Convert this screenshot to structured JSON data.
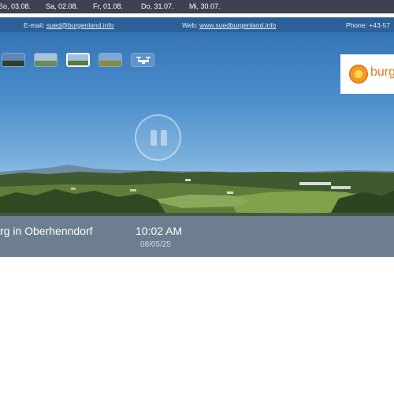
{
  "date_bar": {
    "dates": [
      "So, 03.08.",
      "Sa, 02.08.",
      "Fr, 01.08.",
      "Do, 31.07.",
      "Mi, 30.07."
    ]
  },
  "contact": {
    "email_label": "E-mail:",
    "email": "sued@burgenland.info",
    "web_label": "Web:",
    "web": "www.suedburgenland.info",
    "phone": "Phone: +43-57"
  },
  "thumbnails": {
    "count": 5,
    "active_index": 3
  },
  "logo": {
    "text": "burg"
  },
  "player": {
    "state": "playing",
    "control_icon": "pause-icon"
  },
  "camera": {
    "name": "rg in Oberhenndorf",
    "time": "10:02 AM",
    "date": "08/05/25"
  },
  "colors": {
    "date_bar_bg": "#3c4250",
    "brand_orange": "#e07a1c"
  }
}
